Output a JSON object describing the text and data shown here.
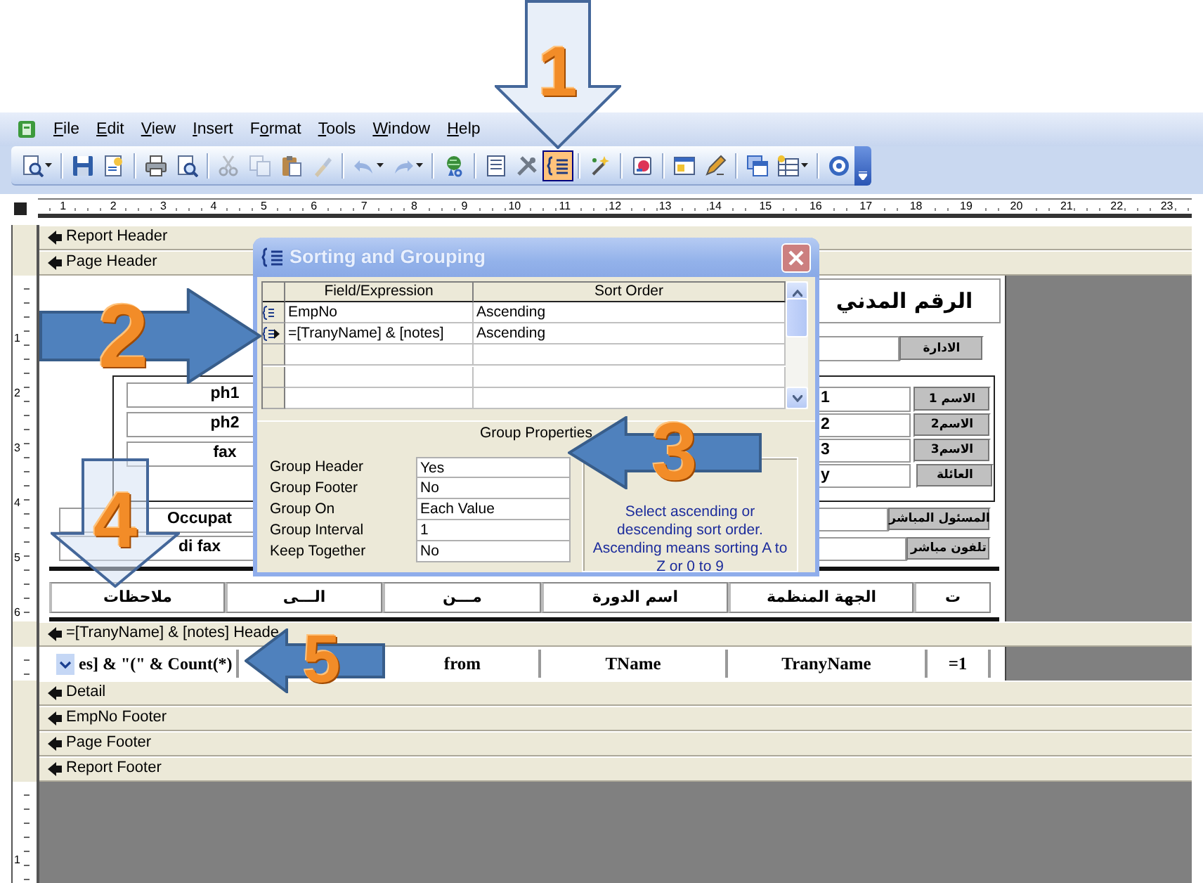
{
  "menu": [
    {
      "label": "File"
    },
    {
      "label": "Edit"
    },
    {
      "label": "View"
    },
    {
      "label": "Insert"
    },
    {
      "label": "Format"
    },
    {
      "label": "Tools"
    },
    {
      "label": "Window"
    },
    {
      "label": "Help"
    }
  ],
  "toolbar": [
    {
      "kind": "split",
      "selected": false,
      "disabled": false
    },
    {
      "kind": "separator"
    },
    {
      "kind": "button",
      "selected": false,
      "disabled": false
    },
    {
      "kind": "button",
      "selected": false,
      "disabled": false
    },
    {
      "kind": "separator"
    },
    {
      "kind": "button",
      "selected": false,
      "disabled": false
    },
    {
      "kind": "button",
      "selected": false,
      "disabled": false
    },
    {
      "kind": "separator"
    },
    {
      "kind": "button",
      "selected": false,
      "disabled": true
    },
    {
      "kind": "button",
      "selected": false,
      "disabled": true
    },
    {
      "kind": "button",
      "selected": false,
      "disabled": false
    },
    {
      "kind": "button",
      "selected": false,
      "disabled": true
    },
    {
      "kind": "separator"
    },
    {
      "kind": "split",
      "selected": false,
      "disabled": true
    },
    {
      "kind": "split",
      "selected": false,
      "disabled": true
    },
    {
      "kind": "separator"
    },
    {
      "kind": "button",
      "selected": false,
      "disabled": false
    },
    {
      "kind": "separator"
    },
    {
      "kind": "button",
      "selected": false,
      "disabled": false
    },
    {
      "kind": "button",
      "selected": false,
      "disabled": false
    },
    {
      "kind": "button",
      "selected": true,
      "disabled": false
    },
    {
      "kind": "separator"
    },
    {
      "kind": "button",
      "selected": false,
      "disabled": false
    },
    {
      "kind": "separator"
    },
    {
      "kind": "button",
      "selected": false,
      "disabled": false
    },
    {
      "kind": "separator"
    },
    {
      "kind": "button",
      "selected": false,
      "disabled": false
    },
    {
      "kind": "button",
      "selected": false,
      "disabled": false
    },
    {
      "kind": "separator"
    },
    {
      "kind": "button",
      "selected": false,
      "disabled": false
    },
    {
      "kind": "split",
      "selected": false,
      "disabled": false
    },
    {
      "kind": "separator"
    },
    {
      "kind": "button",
      "selected": false,
      "disabled": false
    }
  ],
  "ruler": [
    "1",
    "2",
    "3",
    "4",
    "5",
    "6",
    "7",
    "8",
    "9",
    "10",
    "11",
    "12",
    "13",
    "14",
    "15",
    "16",
    "17",
    "18",
    "19",
    "20",
    "21",
    "22",
    "23"
  ],
  "vertical_ruler": {
    "page_header": [
      "1",
      "2",
      "3",
      "4",
      "5",
      "6"
    ],
    "below": [
      "1"
    ]
  },
  "sections": [
    {
      "title": "Report Header"
    },
    {
      "title": "Page Header",
      "controls": [
        {
          "kind": "title",
          "text": "الرقم المدني"
        },
        {
          "kind": "textbox"
        },
        {
          "kind": "label",
          "text": "الادارة"
        },
        {
          "kind": "frame"
        },
        {
          "kind": "textbox",
          "text": "ph1"
        },
        {
          "kind": "textbox",
          "text": "ph2"
        },
        {
          "kind": "textbox",
          "text": "fax"
        },
        {
          "kind": "textbox",
          "text": "1"
        },
        {
          "kind": "textbox",
          "text": "2"
        },
        {
          "kind": "textbox",
          "text": "3"
        },
        {
          "kind": "textbox",
          "text": "y"
        },
        {
          "kind": "label",
          "text": "الاسم 1"
        },
        {
          "kind": "label",
          "text": "الاسم2"
        },
        {
          "kind": "label",
          "text": "الاسم3"
        },
        {
          "kind": "label",
          "text": "العائلة"
        },
        {
          "kind": "textbox",
          "text": "Occupat"
        },
        {
          "kind": "textbox",
          "text": "di fax"
        },
        {
          "kind": "textbox"
        },
        {
          "kind": "label",
          "text": "المسئول المباشر"
        },
        {
          "kind": "textbox"
        },
        {
          "kind": "label",
          "text": "تلفون مباشر"
        },
        {
          "kind": "rule"
        },
        {
          "kind": "cell",
          "text": "ت"
        },
        {
          "kind": "cell",
          "text": "الجهة المنظمة"
        },
        {
          "kind": "cell",
          "text": "اسم الدورة"
        },
        {
          "kind": "cell",
          "text": "مـــن"
        },
        {
          "kind": "cell",
          "text": "الـــى"
        },
        {
          "kind": "cell",
          "text": "ملاحظات"
        },
        {
          "kind": "rule"
        }
      ]
    },
    {
      "title": "=[TranyName] & [notes] Heade",
      "controls": [
        {
          "kind": "combo",
          "text": "es] & \"(\" & Count(*)"
        },
        {
          "kind": "field",
          "text": "from"
        },
        {
          "kind": "field",
          "text": "TName"
        },
        {
          "kind": "field",
          "text": "TranyName"
        },
        {
          "kind": "field",
          "text": "=1"
        }
      ]
    },
    {
      "title": "Detail"
    },
    {
      "title": "EmpNo Footer"
    },
    {
      "title": "Page Footer"
    },
    {
      "title": "Report Footer"
    }
  ],
  "dialog": {
    "title": "Sorting and Grouping",
    "columns": [
      "Field/Expression",
      "Sort Order"
    ],
    "rows": [
      {
        "field": "EmpNo",
        "sort_order": "Ascending",
        "grouped": true,
        "selected": false
      },
      {
        "field": "=[TranyName] & [notes]",
        "sort_order": "Ascending",
        "grouped": true,
        "selected": true
      }
    ],
    "group_properties": "Group Properties",
    "properties": [
      {
        "label": "Group Header",
        "value": "Yes"
      },
      {
        "label": "Group Footer",
        "value": "No"
      },
      {
        "label": "Group On",
        "value": "Each Value"
      },
      {
        "label": "Group Interval",
        "value": "1"
      },
      {
        "label": "Keep Together",
        "value": "No"
      }
    ],
    "help": "Select ascending or descending sort order.  Ascending means sorting A to Z or 0 to 9"
  },
  "callouts": [
    {
      "number": "1",
      "kind": "down"
    },
    {
      "number": "2",
      "kind": "right"
    },
    {
      "number": "3",
      "kind": "left"
    },
    {
      "number": "4",
      "kind": "down"
    },
    {
      "number": "5",
      "kind": "left"
    }
  ]
}
